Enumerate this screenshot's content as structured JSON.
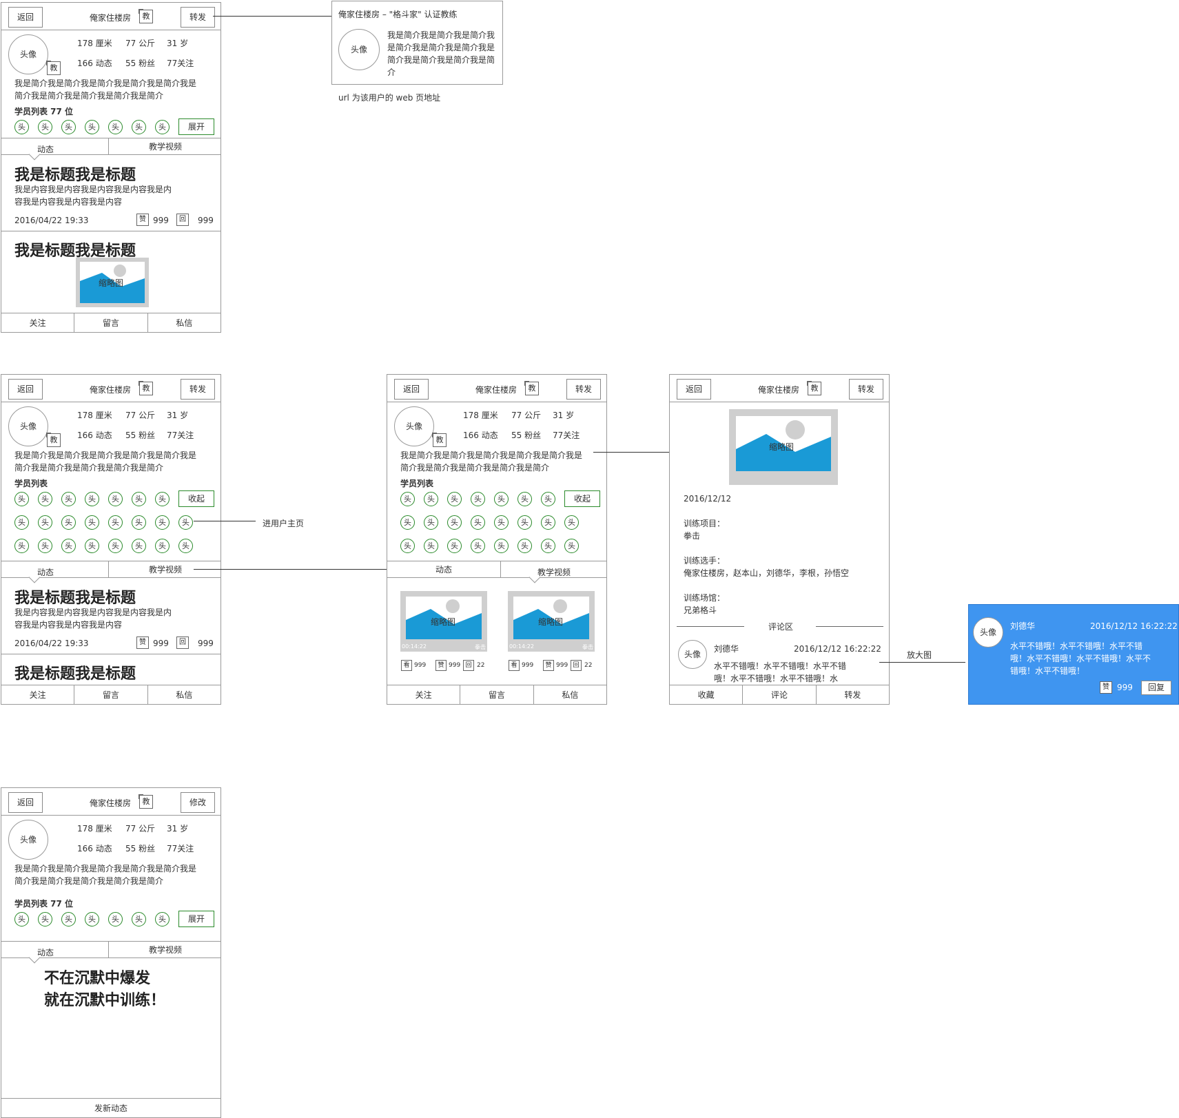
{
  "header": {
    "back": "返回",
    "title": "俺家住楼房",
    "teacher_badge": "教",
    "forward": "转发",
    "edit": "修改"
  },
  "profile": {
    "avatar": "头像",
    "height": "178 厘米",
    "weight": "77 公斤",
    "age": "31 岁",
    "posts": "166 动态",
    "fans": "55 粉丝",
    "follows": "77关注",
    "intro": "我是简介我是简介我是简介我是简介我是简介我是简介我是简介我是简介我是简介我是简介"
  },
  "students": {
    "title_count": "学员列表 77 位",
    "title": "学员列表",
    "head": "头",
    "expand": "展开",
    "collapse": "收起"
  },
  "tabs": {
    "dynamic": "动态",
    "video": "教学视频"
  },
  "post": {
    "title": "我是标题我是标题",
    "content": "我是内容我是内容我是内容我是内容我是内容我是内容我是内容我是内容",
    "time": "2016/04/22 19:33",
    "like": "赞",
    "like_count": "999",
    "reply": "回",
    "reply_count": "999"
  },
  "thumb": {
    "label": "缩略图"
  },
  "video_meta": {
    "duration": "00:14:22",
    "category": "拳击",
    "view": "看",
    "view_count": "999",
    "like": "赞",
    "like_count": "999",
    "reply": "回",
    "reply_count": "22"
  },
  "bottom_bar": {
    "follow": "关注",
    "message": "留言",
    "private": "私信"
  },
  "share_card": {
    "title": "俺家住楼房 – \"格斗家\" 认证教练",
    "avatar": "头像",
    "intro": "我是简介我是简介我是简介我是简介我是简介我是简介我是简介我是简介我是简介我是简介",
    "note": "url 为该用户的 web 页地址"
  },
  "annotations": {
    "enter_user": "进用户主页",
    "zoom": "放大图"
  },
  "detail": {
    "date": "2016/12/12",
    "project_label": "训练项目：",
    "project": "拳击",
    "players_label": "训练选手：",
    "players": "俺家住楼房，赵本山，刘德华，李根，孙悟空",
    "venue_label": "训练场馆：",
    "venue": "兄弟格斗",
    "comments_title": "评论区",
    "comment_user": "刘德华",
    "comment_time": "2016/12/12 16:22:22",
    "comment_text": "水平不错哦！水平不错哦！水平不错哦！水平不错哦！水平不错哦！水",
    "bar_collect": "收藏",
    "bar_comment": "评论",
    "bar_forward": "转发"
  },
  "comment_zoom": {
    "avatar": "头像",
    "user": "刘德华",
    "time": "2016/12/12 16:22:22",
    "text": "水平不错哦！水平不错哦！水平不错哦！水平不错哦！水平不错哦！水平不错哦！水平不错哦！",
    "like": "赞",
    "like_count": "999",
    "reply": "回复"
  },
  "own_page": {
    "slogan_line1": "不在沉默中爆发",
    "slogan_line2": "就在沉默中训练！",
    "new_post": "发新动态"
  },
  "colors": {
    "accent_green": "#2a8a2a",
    "image_blue": "#1a9ad6",
    "zoom_bg": "#3f95f0",
    "frame_gray": "#999999"
  }
}
